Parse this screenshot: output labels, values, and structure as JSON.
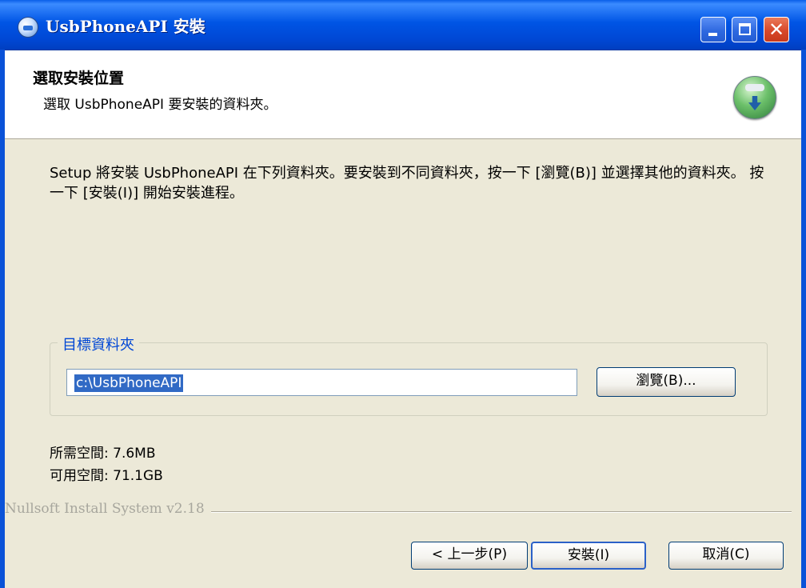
{
  "window": {
    "title": "UsbPhoneAPI 安裝",
    "controls": {
      "minimize": "",
      "maximize": "",
      "close": "✕"
    }
  },
  "header": {
    "title": "選取安裝位置",
    "subtitle": "選取 UsbPhoneAPI 要安裝的資料夾。"
  },
  "body": {
    "description": "Setup 將安裝 UsbPhoneAPI 在下列資料夾。要安裝到不同資料夾，按一下 [瀏覽(B)] 並選擇其他的資料夾。 按一下 [安裝(I)] 開始安裝進程。",
    "destination": {
      "legend": "目標資料夾",
      "path": "c:\\UsbPhoneAPI",
      "browse_label": "瀏覽(B)..."
    },
    "space_required": "所需空間: 7.6MB",
    "space_available": "可用空間: 71.1GB"
  },
  "footer": {
    "branding": "Nullsoft Install System v2.18",
    "back_label": "< 上一步(P)",
    "install_label": "安裝(I)",
    "cancel_label": "取消(C)"
  },
  "colors": {
    "titlebar": "#0055e5",
    "dialog_bg": "#ece9d8",
    "selection": "#316ac5",
    "legend_text": "#0046d5"
  },
  "icons": [
    "app-icon",
    "installer-disc-icon",
    "minimize-icon",
    "maximize-icon",
    "close-icon"
  ]
}
